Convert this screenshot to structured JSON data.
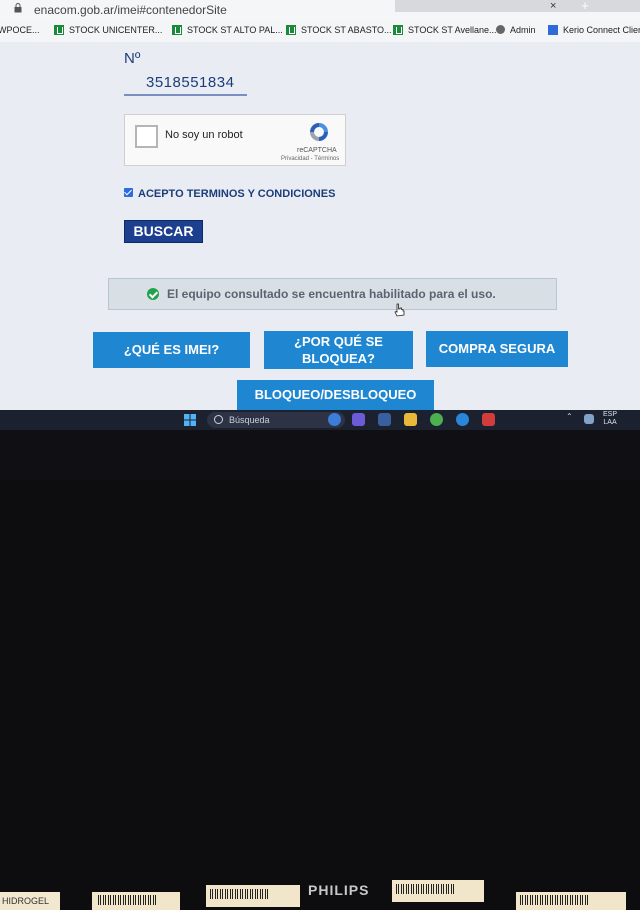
{
  "browser": {
    "url": "enacom.gob.ar/imei#contenedorSite",
    "tab_close": "×",
    "tab_new": "+"
  },
  "bookmarks": [
    {
      "label": "WPOCE..."
    },
    {
      "label": "STOCK UNICENTER..."
    },
    {
      "label": "STOCK ST ALTO PAL..."
    },
    {
      "label": "STOCK ST ABASTO..."
    },
    {
      "label": "STOCK ST Avellane..."
    },
    {
      "label": "Admin"
    },
    {
      "label": "Kerio Connect Client"
    }
  ],
  "form": {
    "field_label": "Nº",
    "imei_value": "3518551834",
    "captcha": {
      "label": "No soy un robot",
      "brand": "reCAPTCHA",
      "links": "Privacidad - Términos"
    },
    "terms_label": "ACEPTO TERMINOS Y CONDICIONES",
    "search_button": "BUSCAR"
  },
  "result": {
    "message": "El equipo consultado se encuentra habilitado para el uso.",
    "status_color": "#23a24d"
  },
  "nav": {
    "what_is_imei": "¿QUÉ ES IMEI?",
    "why_blocked_line1": "¿POR QUÉ SE",
    "why_blocked_line2": "BLOQUEA?",
    "safe_purchase": "COMPRA SEGURA",
    "block_unblock": "BLOQUEO/DESBLOQUEO"
  },
  "taskbar": {
    "search_placeholder": "Búsqueda",
    "lang_line1": "ESP",
    "lang_line2": "LAA"
  },
  "monitor": {
    "brand": "PHILIPS",
    "sticker_text": "HIDROGEL"
  },
  "colors": {
    "button_blue": "#1f87d2",
    "buscar_navy": "#1d3f8f",
    "text_navy": "#1c3d7a"
  }
}
